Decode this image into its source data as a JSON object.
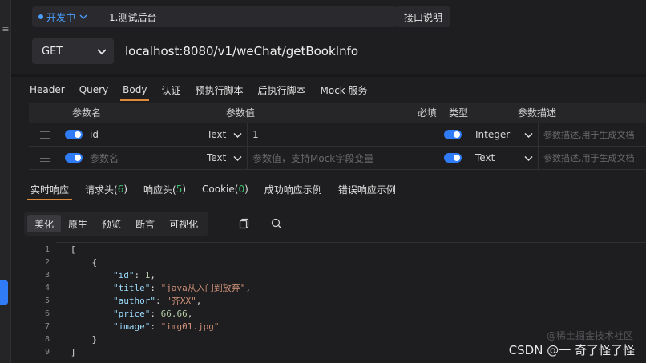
{
  "rail": {
    "glyph": "≡"
  },
  "header": {
    "status": "开发中",
    "name": "1.测试后台",
    "doc_button": "接口说明"
  },
  "request": {
    "method": "GET",
    "url": "localhost:8080/v1/weChat/getBookInfo"
  },
  "request_tabs": [
    "Header",
    "Query",
    "Body",
    "认证",
    "预执行脚本",
    "后执行脚本",
    "Mock 服务"
  ],
  "request_tab_active": "Body",
  "params": {
    "headers": [
      "参数名",
      "参数值",
      "必填",
      "类型",
      "参数描述"
    ],
    "rows": [
      {
        "name": "id",
        "name_type": "Text",
        "value": "1",
        "type": "Integer",
        "desc": "参数描述,用于生成文档"
      },
      {
        "name": "参数名",
        "name_type": "Text",
        "value": "参数值，支持Mock字段变量",
        "type": "Text",
        "desc": "参数描述,用于生成文档"
      }
    ]
  },
  "response_tabs": [
    {
      "label": "实时响应",
      "count": ""
    },
    {
      "label": "请求头(",
      "count": "6",
      "close": ")"
    },
    {
      "label": "响应头(",
      "count": "5",
      "close": ")"
    },
    {
      "label": "Cookie(",
      "count": "0",
      "close": ")"
    },
    {
      "label": "成功响应示例",
      "count": ""
    },
    {
      "label": "错误响应示例",
      "count": ""
    }
  ],
  "view_buttons": [
    "美化",
    "原生",
    "预览",
    "断言",
    "可视化"
  ],
  "view_active": "美化",
  "code": {
    "line_numbers": [
      "1",
      "2",
      "3",
      "4",
      "5",
      "6",
      "7",
      "8",
      "9"
    ],
    "id_key": "\"id\"",
    "id_val": "1",
    "title_key": "\"title\"",
    "title_val": "\"java从入门到放弃\"",
    "author_key": "\"author\"",
    "author_val": "\"齐XX\"",
    "price_key": "\"price\"",
    "price_val": "66.66",
    "image_key": "\"image\"",
    "image_val": "\"img01.jpg\""
  },
  "watermark": {
    "faint": "@稀土掘金技术社区",
    "main": "CSDN @⼀ 奇了怪了怪"
  },
  "colors": {
    "accent": "#2f7cf6",
    "tab_underline": "#e08a3c",
    "count": "#3fbf6f"
  }
}
